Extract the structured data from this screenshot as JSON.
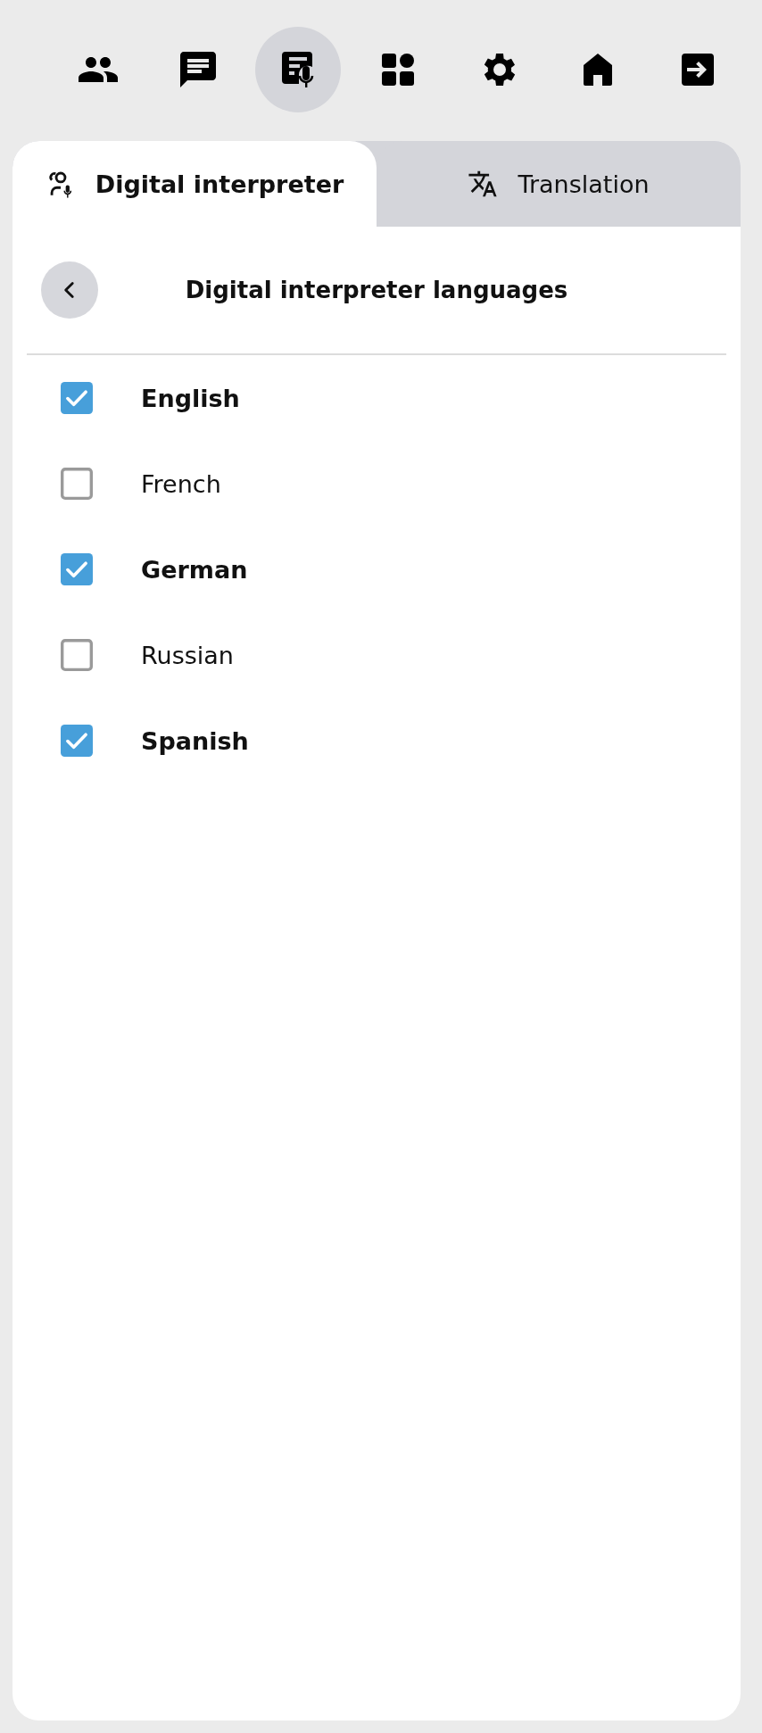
{
  "nav": [
    {
      "kind": "people",
      "selected": false
    },
    {
      "kind": "chat",
      "selected": false
    },
    {
      "kind": "interpreter",
      "selected": true
    },
    {
      "kind": "apps",
      "selected": false
    },
    {
      "kind": "settings",
      "selected": false
    },
    {
      "kind": "home",
      "selected": false
    },
    {
      "kind": "logout",
      "selected": false
    }
  ],
  "tabs": [
    {
      "kind": "interpreter",
      "label": "Digital interpreter",
      "selected": true
    },
    {
      "kind": "translate",
      "label": "Translation",
      "selected": false
    }
  ],
  "header": {
    "title": "Digital interpreter languages"
  },
  "languages": [
    {
      "label": "English",
      "checked": true
    },
    {
      "label": "French",
      "checked": false
    },
    {
      "label": "German",
      "checked": true
    },
    {
      "label": "Russian",
      "checked": false
    },
    {
      "label": "Spanish",
      "checked": true
    }
  ]
}
